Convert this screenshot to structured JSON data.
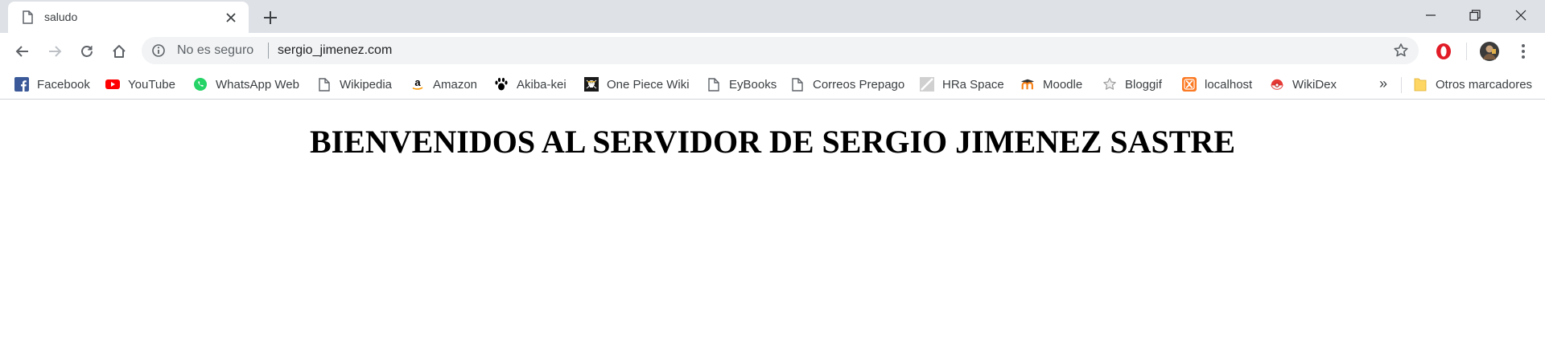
{
  "tab": {
    "title": "saludo"
  },
  "toolbar": {
    "security_label": "No es seguro",
    "url": "sergio_jimenez.com"
  },
  "bookmarks": [
    {
      "label": "Facebook",
      "icon": "facebook-icon",
      "color": "#3b5998"
    },
    {
      "label": "YouTube",
      "icon": "youtube-icon",
      "color": "#ff0000"
    },
    {
      "label": "WhatsApp Web",
      "icon": "whatsapp-icon",
      "color": "#25d366"
    },
    {
      "label": "Wikipedia",
      "icon": "page-icon",
      "color": "#5f6368"
    },
    {
      "label": "Amazon",
      "icon": "amazon-icon",
      "color": "#000000"
    },
    {
      "label": "Akiba-kei",
      "icon": "paw-icon",
      "color": "#000000"
    },
    {
      "label": "One Piece Wiki",
      "icon": "skull-icon",
      "color": "#000000"
    },
    {
      "label": "EyBooks",
      "icon": "page-icon",
      "color": "#5f6368"
    },
    {
      "label": "Correos Prepago",
      "icon": "page-icon",
      "color": "#5f6368"
    },
    {
      "label": "HRa Space",
      "icon": "hra-icon",
      "color": "#bdbdbd"
    },
    {
      "label": "Moodle",
      "icon": "moodle-icon",
      "color": "#f98012"
    },
    {
      "label": "Bloggif",
      "icon": "star-outline-icon",
      "color": "#9e9e9e"
    },
    {
      "label": "localhost",
      "icon": "xampp-icon",
      "color": "#fb7a24"
    },
    {
      "label": "WikiDex",
      "icon": "pokeball-icon",
      "color": "#e53935"
    }
  ],
  "other_bookmarks": {
    "label": "Otros marcadores",
    "icon": "folder-icon",
    "color": "#fdd663"
  },
  "overflow": "»",
  "page": {
    "heading": "BIENVENIDOS AL SERVIDOR DE SERGIO JIMENEZ SASTRE"
  }
}
